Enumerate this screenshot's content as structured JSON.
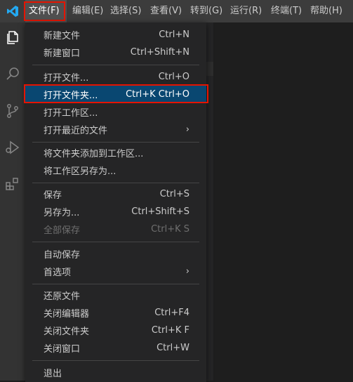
{
  "menubar": {
    "items": [
      {
        "label": "文件(F)",
        "active": true
      },
      {
        "label": "编辑(E)"
      },
      {
        "label": "选择(S)"
      },
      {
        "label": "查看(V)"
      },
      {
        "label": "转到(G)"
      },
      {
        "label": "运行(R)"
      },
      {
        "label": "终端(T)"
      },
      {
        "label": "帮助(H)"
      }
    ]
  },
  "activitybar": {
    "icons": [
      "explorer-icon",
      "search-icon",
      "source-control-icon",
      "run-debug-icon",
      "extensions-icon"
    ]
  },
  "file_menu": {
    "items": [
      {
        "label": "新建文件",
        "shortcut": "Ctrl+N"
      },
      {
        "label": "新建窗口",
        "shortcut": "Ctrl+Shift+N"
      },
      {
        "label": "打开文件...",
        "shortcut": "Ctrl+O"
      },
      {
        "label": "打开文件夹...",
        "shortcut": "Ctrl+K Ctrl+O",
        "highlighted": true
      },
      {
        "label": "打开工作区..."
      },
      {
        "label": "打开最近的文件",
        "submenu": true
      },
      {
        "label": "将文件夹添加到工作区..."
      },
      {
        "label": "将工作区另存为..."
      },
      {
        "label": "保存",
        "shortcut": "Ctrl+S"
      },
      {
        "label": "另存为...",
        "shortcut": "Ctrl+Shift+S"
      },
      {
        "label": "全部保存",
        "shortcut": "Ctrl+K S",
        "disabled": true
      },
      {
        "label": "自动保存"
      },
      {
        "label": "首选项",
        "submenu": true
      },
      {
        "label": "还原文件"
      },
      {
        "label": "关闭编辑器",
        "shortcut": "Ctrl+F4"
      },
      {
        "label": "关闭文件夹",
        "shortcut": "Ctrl+K F"
      },
      {
        "label": "关闭窗口",
        "shortcut": "Ctrl+W"
      },
      {
        "label": "退出"
      }
    ],
    "submenu_glyph": "›"
  },
  "colors": {
    "highlight": "#094771",
    "annotation_red": "#e51400",
    "vscode_blue": "#23a9f2"
  }
}
